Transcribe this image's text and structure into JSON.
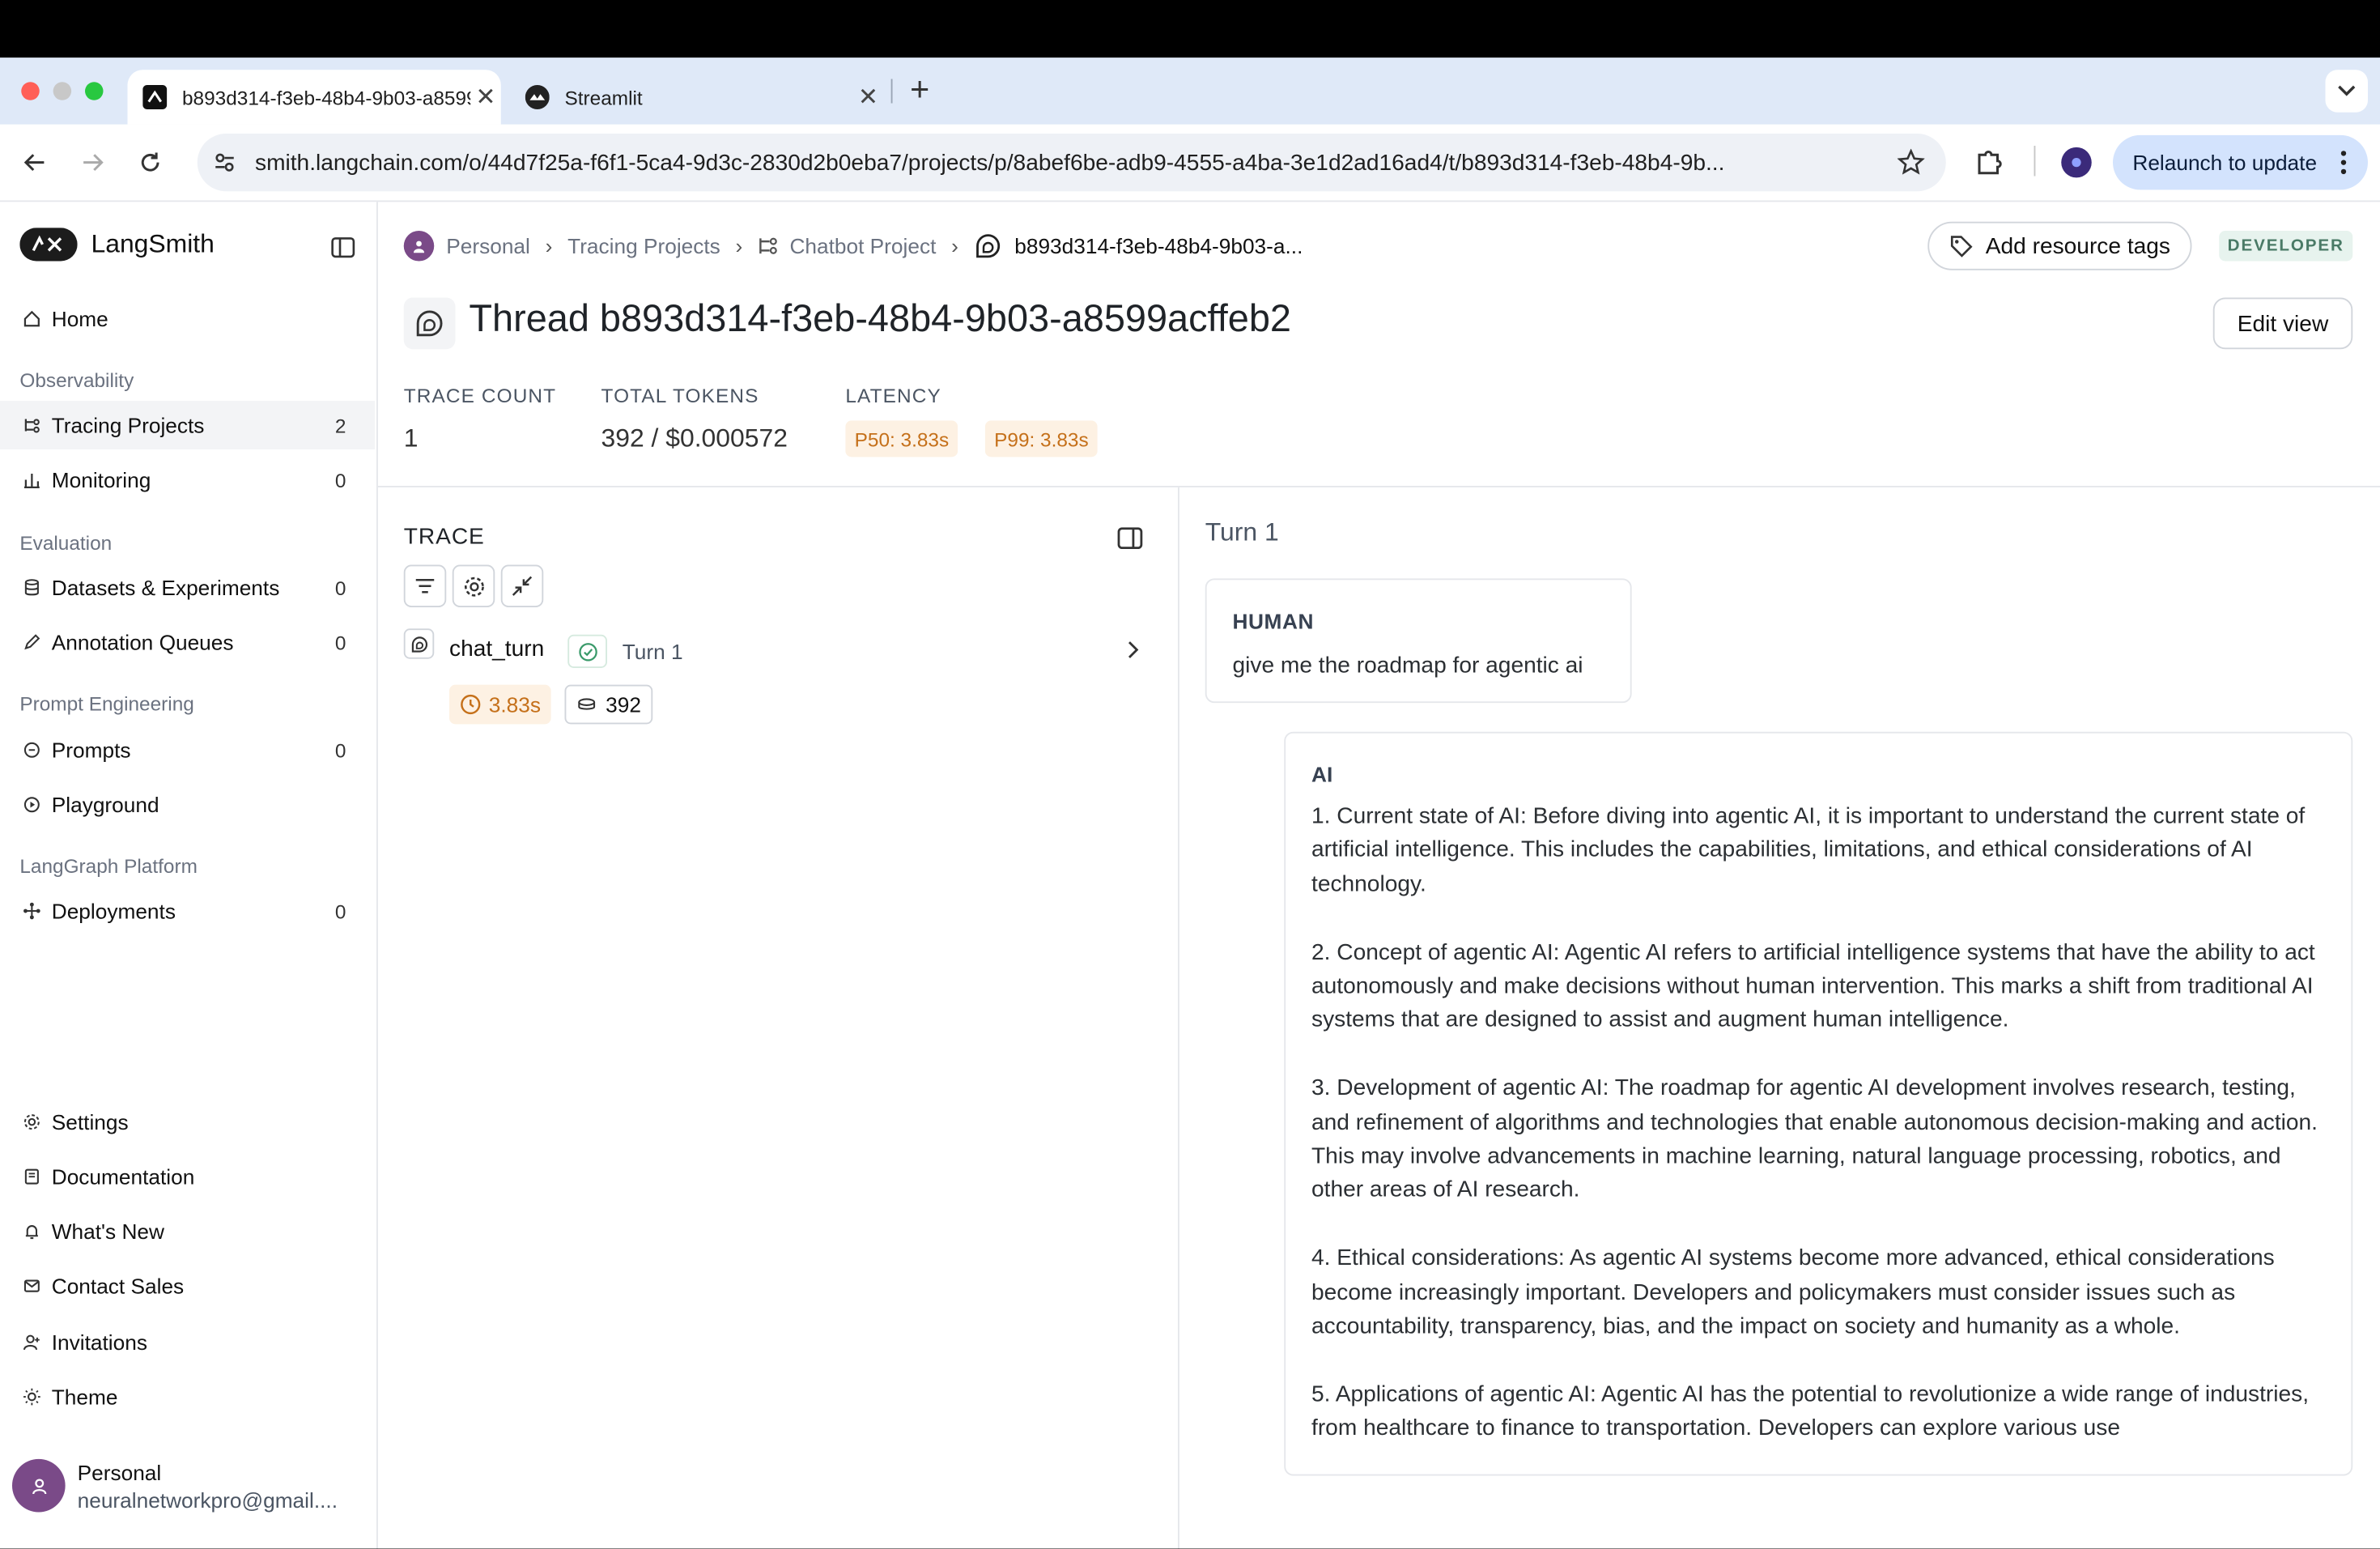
{
  "browser": {
    "tabs": [
      {
        "title": "b893d314-f3eb-48b4-9b03-a8599acffeb2",
        "active": true
      },
      {
        "title": "Streamlit",
        "active": false
      }
    ],
    "url": "smith.langchain.com/o/44d7f25a-f6f1-5ca4-9d3c-2830d2b0eba7/projects/p/8abef6be-adb9-4555-a4ba-3e1d2ad16ad4/t/b893d314-f3eb-48b4-9b...",
    "relaunch_label": "Relaunch to update"
  },
  "sidebar": {
    "brand": "LangSmith",
    "home": "Home",
    "sections": {
      "observability": "Observability",
      "evaluation": "Evaluation",
      "prompt_engineering": "Prompt Engineering",
      "langgraph": "LangGraph Platform"
    },
    "items": {
      "tracing": {
        "label": "Tracing Projects",
        "count": "2"
      },
      "monitoring": {
        "label": "Monitoring",
        "count": "0"
      },
      "datasets": {
        "label": "Datasets & Experiments",
        "count": "0"
      },
      "annotation": {
        "label": "Annotation Queues",
        "count": "0"
      },
      "prompts": {
        "label": "Prompts",
        "count": "0"
      },
      "playground": {
        "label": "Playground"
      },
      "deployments": {
        "label": "Deployments",
        "count": "0"
      }
    },
    "bottom": {
      "settings": "Settings",
      "documentation": "Documentation",
      "whats_new": "What's New",
      "contact_sales": "Contact Sales",
      "invitations": "Invitations",
      "theme": "Theme"
    },
    "user": {
      "name": "Personal",
      "email": "neuralnetworkpro@gmail...."
    }
  },
  "breadcrumb": {
    "personal": "Personal",
    "tracing": "Tracing Projects",
    "project": "Chatbot Project",
    "thread": "b893d314-f3eb-48b4-9b03-a..."
  },
  "header": {
    "add_tags": "Add resource tags",
    "badge": "DEVELOPER",
    "title": "Thread b893d314-f3eb-48b4-9b03-a8599acffeb2",
    "edit_view": "Edit view"
  },
  "stats": {
    "trace_count_label": "TRACE COUNT",
    "trace_count": "1",
    "total_tokens_label": "TOTAL TOKENS",
    "total_tokens": "392 / $0.000572",
    "latency_label": "LATENCY",
    "p50": "P50: 3.83s",
    "p99": "P99: 3.83s"
  },
  "trace": {
    "heading": "TRACE",
    "run": {
      "name": "chat_turn",
      "turn": "Turn 1",
      "latency": "3.83s",
      "tokens": "392"
    }
  },
  "turn": {
    "heading": "Turn 1",
    "human_label": "HUMAN",
    "human_text": "give me the roadmap for agentic ai",
    "ai_label": "AI",
    "ai_paragraphs": [
      "1. Current state of AI: Before diving into agentic AI, it is important to understand the current state of artificial intelligence. This includes the capabilities, limitations, and ethical considerations of AI technology.",
      "2. Concept of agentic AI: Agentic AI refers to artificial intelligence systems that have the ability to act autonomously and make decisions without human intervention. This marks a shift from traditional AI systems that are designed to assist and augment human intelligence.",
      "3. Development of agentic AI: The roadmap for agentic AI development involves research, testing, and refinement of algorithms and technologies that enable autonomous decision-making and action. This may involve advancements in machine learning, natural language processing, robotics, and other areas of AI research.",
      "4. Ethical considerations: As agentic AI systems become more advanced, ethical considerations become increasingly important. Developers and policymakers must consider issues such as accountability, transparency, bias, and the impact on society and humanity as a whole.",
      "5. Applications of agentic AI: Agentic AI has the potential to revolutionize a wide range of industries, from healthcare to finance to transportation. Developers can explore various use"
    ]
  },
  "colors": {
    "accent_orange": "#c5701a",
    "developer_badge": "#4a7a66",
    "relaunch_bg": "#d3e3fd"
  }
}
